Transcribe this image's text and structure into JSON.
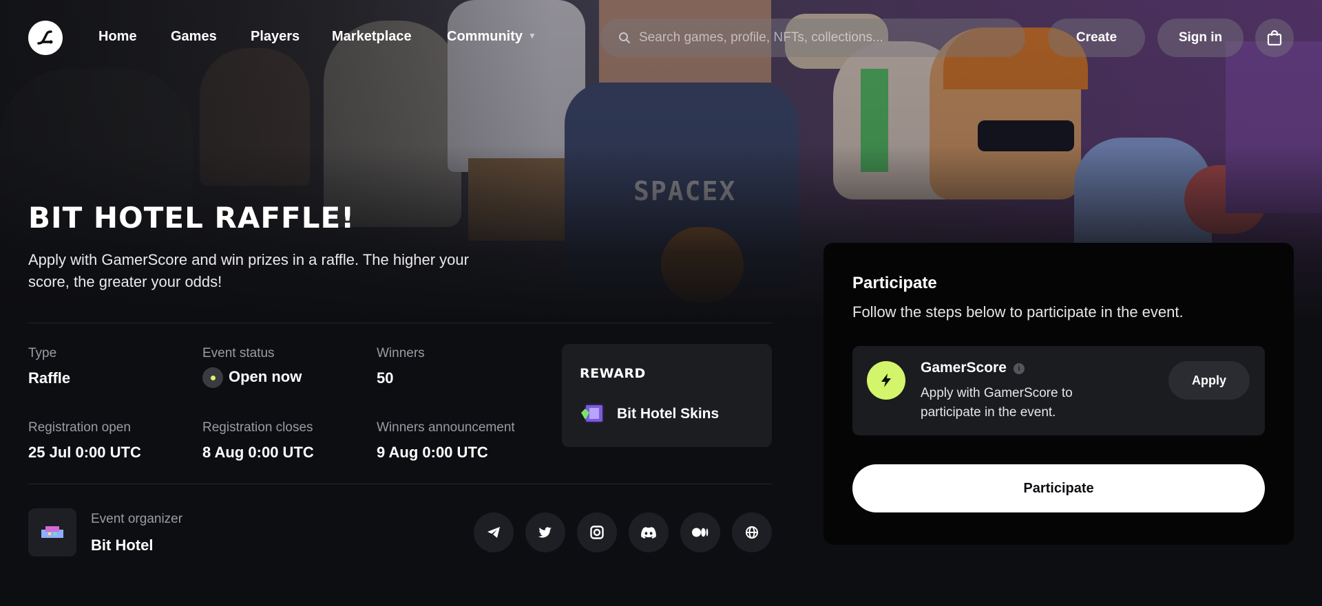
{
  "nav": {
    "links": [
      "Home",
      "Games",
      "Players",
      "Marketplace",
      "Community"
    ],
    "search_placeholder": "Search games, profile, NFTs, collections...",
    "create_label": "Create",
    "signin_label": "Sign in",
    "icons": [
      "logo-icon",
      "search-icon",
      "chevron-down-icon",
      "bag-icon"
    ]
  },
  "event": {
    "title": "BIT HOTEL RAFFLE!",
    "subtitle": "Apply with GamerScore and win prizes in a raffle. The higher your score, the greater your odds!",
    "type_label": "Type",
    "type_value": "Raffle",
    "status_label": "Event status",
    "status_value": "Open now",
    "winners_label": "Winners",
    "winners_value": "50",
    "reg_open_label": "Registration open",
    "reg_open_value": "25 Jul 0:00 UTC",
    "reg_close_label": "Registration closes",
    "reg_close_value": "8 Aug 0:00 UTC",
    "announce_label": "Winners announcement",
    "announce_value": "9 Aug 0:00 UTC"
  },
  "reward": {
    "title": "REWARD",
    "item": "Bit Hotel Skins"
  },
  "organizer": {
    "label": "Event organizer",
    "name": "Bit Hotel",
    "socials": [
      "telegram-icon",
      "twitter-icon",
      "instagram-icon",
      "discord-icon",
      "medium-icon",
      "globe-icon"
    ]
  },
  "participate": {
    "title": "Participate",
    "description": "Follow the steps below to participate in the event.",
    "step_title": "GamerScore",
    "step_desc": "Apply with GamerScore to participate in the event.",
    "apply_label": "Apply",
    "button_label": "Participate"
  },
  "colors": {
    "background": "#0d0e11",
    "accent": "#d3f56b",
    "panel": "#050506",
    "card": "#1b1c20"
  }
}
